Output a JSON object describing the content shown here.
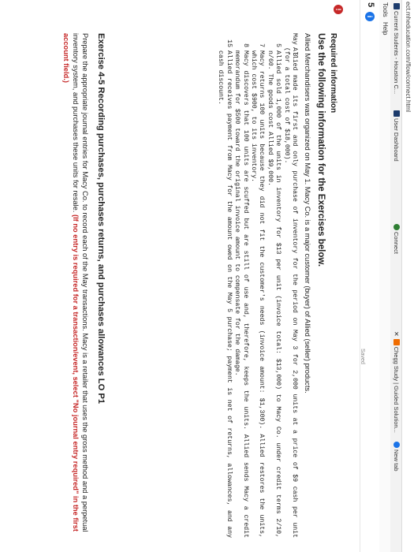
{
  "browser": {
    "url": "ect.mheducation.com/flow/connect.html",
    "bookmarks": [
      {
        "label": "Current Students - Houston C...",
        "color": "#1b3a6b"
      },
      {
        "label": "User Dashboard",
        "color": "#1b3a6b"
      },
      {
        "label": "Connect",
        "color": "#2e7d32"
      },
      {
        "label": "Chegg Study | Guided Solution...",
        "color": "#ef6c00"
      },
      {
        "label": "New tab",
        "color": "#1a73e8"
      }
    ],
    "menu": [
      "Tools",
      "Help"
    ]
  },
  "toolbar": {
    "question_number": "5",
    "info_icon": "i",
    "saved_label": "Saved"
  },
  "alert_icon": "!",
  "content": {
    "required_heading": "Required information",
    "use_heading": "Use the following information for the Exercises below.",
    "intro": "Allied Merchandisers was organized on May 1. Macy Co. is a major customer (buyer) of Allied (seller) products.",
    "transactions": [
      {
        "day": "May  3",
        "text": "Allied made its first and only purchase of inventory for the period on May 3 for 2,000 units at a price of $9 cash per unit (for a total cost of $18,000)."
      },
      {
        "day": "5",
        "text": "Allied sold 1,000 of the units in inventory for $13 per unit (invoice total: $13,000) to Macy Co. under credit terms 2/10, n/60. The goods cost Allied $9,000."
      },
      {
        "day": "7",
        "text": "Macy returns 100 units because they did not fit the customer's needs (invoice amount: $1,300). Allied restores the units, which cost $900, to its inventory."
      },
      {
        "day": "8",
        "text": "Macy discovers that 100 units are scuffed but are still of use and, therefore, keeps the units. Allied sends Macy a credit memorandum for $500 toward the original invoice amount to compensate for the damage."
      },
      {
        "day": "15",
        "text": "Allied receives payment from Macy for the amount owed on the May 5 purchase; payment is net of returns, allowances, and any cash discount."
      }
    ]
  },
  "exercise": {
    "title": "Exercise 4-5 Recording purchases, purchases returns, and purchases allowances LO P1",
    "body": "Prepare the appropriate journal entries for Macy Co. to record each of the May transactions. Macy is a retailer that uses the gross method and a perpetual inventory system, and purchases these units for resale.",
    "note": "(If no entry is required for a transaction/event, select \"No journal entry required\" in the first account field.)"
  }
}
